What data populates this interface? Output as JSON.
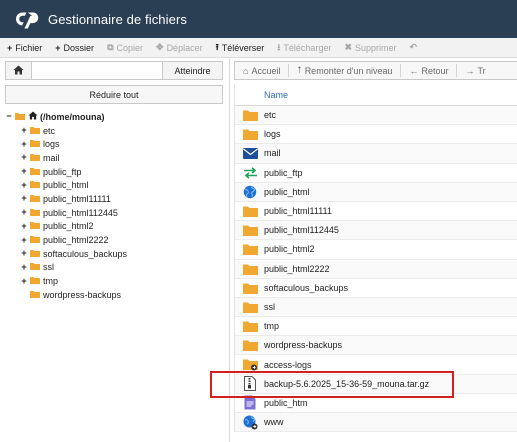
{
  "app": {
    "title": "Gestionnaire de fichiers"
  },
  "toolbar": {
    "items": [
      {
        "icon": "plus-icon",
        "glyph": "+",
        "label": "Fichier",
        "enabled": true
      },
      {
        "icon": "plus-icon",
        "glyph": "+",
        "label": "Dossier",
        "enabled": true
      },
      {
        "icon": "copy-icon",
        "glyph": "⧉",
        "label": "Copier",
        "enabled": false
      },
      {
        "icon": "move-icon",
        "glyph": "✥",
        "label": "Déplacer",
        "enabled": false
      },
      {
        "icon": "upload-icon",
        "glyph": "⭱",
        "label": "Téléverser",
        "enabled": true
      },
      {
        "icon": "download-icon",
        "glyph": "⭳",
        "label": "Télécharger",
        "enabled": false
      },
      {
        "icon": "delete-icon",
        "glyph": "✖",
        "label": "Supprimer",
        "enabled": false
      },
      {
        "icon": "restore-icon",
        "glyph": "↶",
        "label": "",
        "enabled": false
      }
    ]
  },
  "path_bar": {
    "value": "",
    "go_label": "Atteindre"
  },
  "collapse_label": "Réduire tout",
  "tree": {
    "root": {
      "toggle": "−",
      "label": "(/home/mouna)"
    },
    "children": [
      {
        "toggle": "+",
        "label": "etc"
      },
      {
        "toggle": "+",
        "label": "logs"
      },
      {
        "toggle": "+",
        "label": "mail"
      },
      {
        "toggle": "+",
        "label": "public_ftp"
      },
      {
        "toggle": "+",
        "label": "public_html"
      },
      {
        "toggle": "+",
        "label": "public_html11111"
      },
      {
        "toggle": "+",
        "label": "public_html112445"
      },
      {
        "toggle": "+",
        "label": "public_html2"
      },
      {
        "toggle": "+",
        "label": "public_html2222"
      },
      {
        "toggle": "+",
        "label": "softaculous_backups"
      },
      {
        "toggle": "+",
        "label": "ssl"
      },
      {
        "toggle": "+",
        "label": "tmp"
      },
      {
        "toggle": "",
        "label": "wordpress-backups"
      }
    ]
  },
  "right_toolbar": {
    "items": [
      {
        "icon": "home-icon",
        "glyph": "⌂",
        "label": "Accueil"
      },
      {
        "icon": "level-up-icon",
        "glyph": "⭡",
        "label": "Remonter d'un niveau"
      },
      {
        "icon": "back-arrow-icon",
        "glyph": "←",
        "label": "Retour"
      },
      {
        "icon": "forward-arrow-icon",
        "glyph": "→",
        "label": "Tr"
      }
    ]
  },
  "file_list": {
    "column_name": "Name",
    "rows": [
      {
        "type": "folder",
        "name": "etc"
      },
      {
        "type": "folder",
        "name": "logs"
      },
      {
        "type": "mail",
        "name": "mail"
      },
      {
        "type": "ftp",
        "name": "public_ftp"
      },
      {
        "type": "globe",
        "name": "public_html"
      },
      {
        "type": "folder",
        "name": "public_html11111"
      },
      {
        "type": "folder",
        "name": "public_html112445"
      },
      {
        "type": "folder",
        "name": "public_html2"
      },
      {
        "type": "folder",
        "name": "public_html2222"
      },
      {
        "type": "folder",
        "name": "softaculous_backups"
      },
      {
        "type": "folder",
        "name": "ssl"
      },
      {
        "type": "folder",
        "name": "tmp"
      },
      {
        "type": "folder",
        "name": "wordpress-backups"
      },
      {
        "type": "folder-link",
        "name": "access-logs"
      },
      {
        "type": "archive",
        "name": "backup-5.6.2025_15-36-59_mouna.tar.gz"
      },
      {
        "type": "file",
        "name": "public_htm"
      },
      {
        "type": "globe-link",
        "name": "www"
      }
    ]
  },
  "colors": {
    "header_bg": "#2a3f54",
    "folder": "#f0a830",
    "link_blue": "#2b6cb0",
    "highlight": "#d21f1f"
  }
}
